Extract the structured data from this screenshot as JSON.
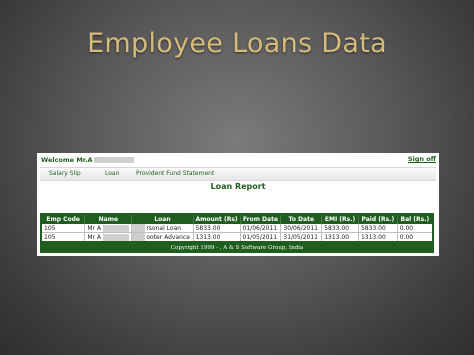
{
  "slide": {
    "title": "Employee Loans Data"
  },
  "header": {
    "welcome": "Welcome Mr.A",
    "signoff": "Sign off"
  },
  "nav": {
    "items": [
      "Salary Slip",
      "Loan",
      "Provident Fund Statement"
    ]
  },
  "report": {
    "title": "Loan Report"
  },
  "table": {
    "headers": [
      "Emp Code",
      "Name",
      "Loan",
      "Amount (Rs)",
      "From Date",
      "To Date",
      "EMI (Rs.)",
      "Paid (Rs.)",
      "Bal (Rs.)"
    ],
    "rows": [
      [
        "105",
        "Mr A",
        "rsonal Loan",
        "5833.00",
        "01/06/2011",
        "30/06/2011",
        "5833.00",
        "5833.00",
        "0.00"
      ],
      [
        "105",
        "Mr A",
        "ooter Advance",
        "1313.00",
        "01/05/2011",
        "31/05/2011",
        "1313.00",
        "1313.00",
        "0.00"
      ]
    ]
  },
  "footer": {
    "copyright": "Copyright 1999 - , A & S Software Group, India"
  }
}
